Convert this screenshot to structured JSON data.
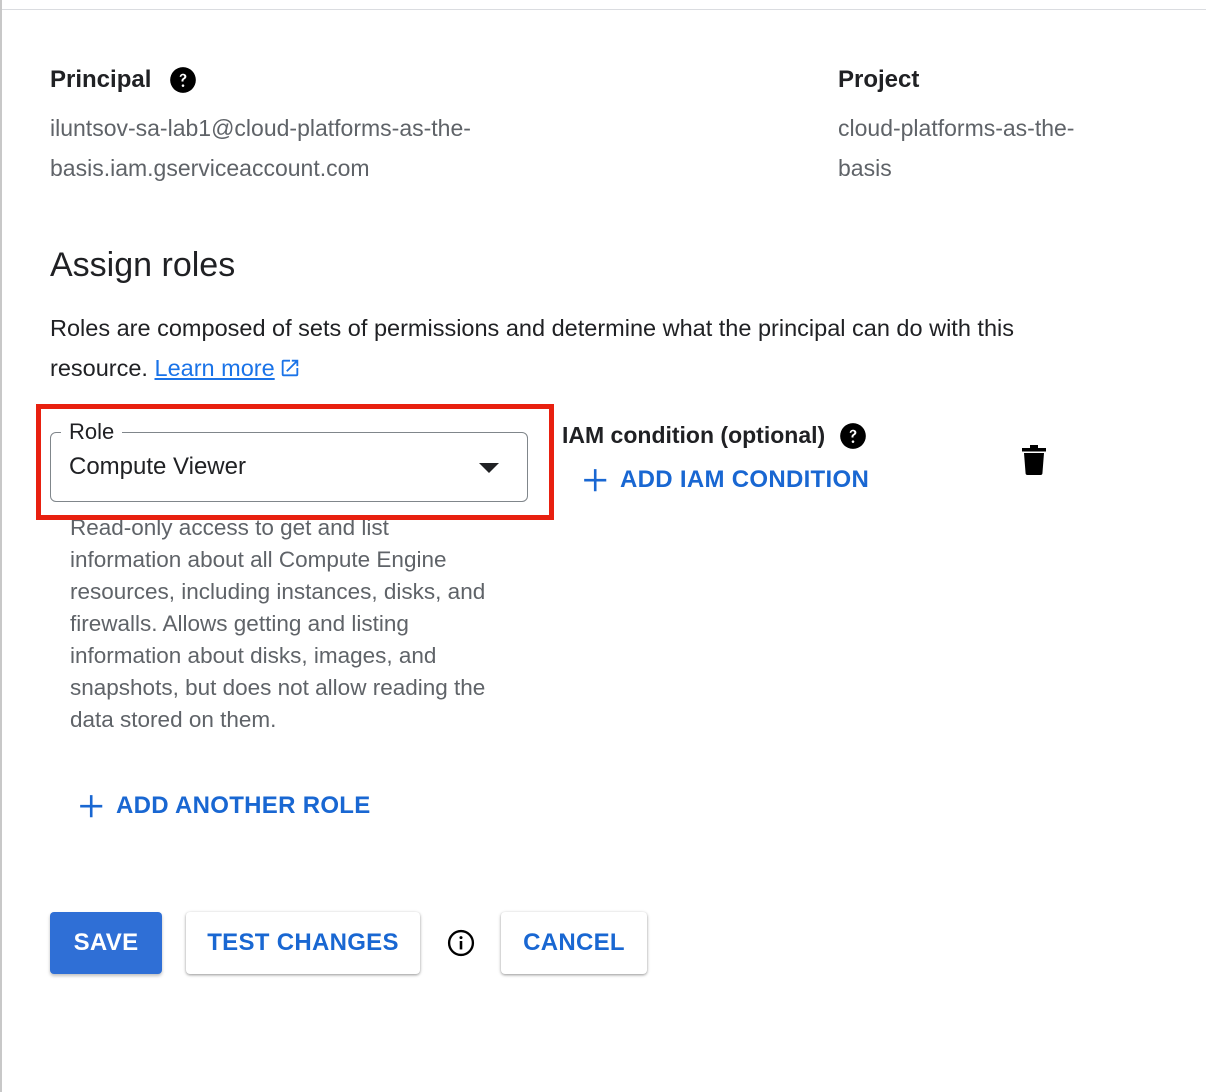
{
  "principal": {
    "label": "Principal",
    "value_line1": "iluntsov-sa-lab1@cloud-platforms-as-the-",
    "value_line2": "basis.iam.gserviceaccount.com"
  },
  "project": {
    "label": "Project",
    "value_line1": "cloud-platforms-as-the-",
    "value_line2": "basis"
  },
  "assign_roles": {
    "title": "Assign roles",
    "description": "Roles are composed of sets of permissions and determine what the principal can do with this resource.",
    "learn_more": "Learn more"
  },
  "role": {
    "field_label": "Role",
    "selected": "Compute Viewer",
    "description": "Read-only access to get and list information about all Compute Engine resources, including instances, disks, and firewalls. Allows getting and listing information about disks, images, and snapshots, but does not allow reading the data stored on them."
  },
  "iam_condition": {
    "label": "IAM condition (optional)",
    "add_button": "ADD IAM CONDITION"
  },
  "add_another_role": "ADD ANOTHER ROLE",
  "actions": {
    "save": "SAVE",
    "test_changes": "TEST CHANGES",
    "cancel": "CANCEL"
  },
  "colors": {
    "accent": "#1967d2",
    "primary_button": "#2f6fd6",
    "highlight_box": "#e8200f"
  },
  "icons": {
    "help": "help-icon",
    "external_link": "external-link-icon",
    "dropdown": "chevron-down-icon",
    "delete": "trash-icon",
    "add": "plus-icon",
    "info": "info-icon"
  }
}
